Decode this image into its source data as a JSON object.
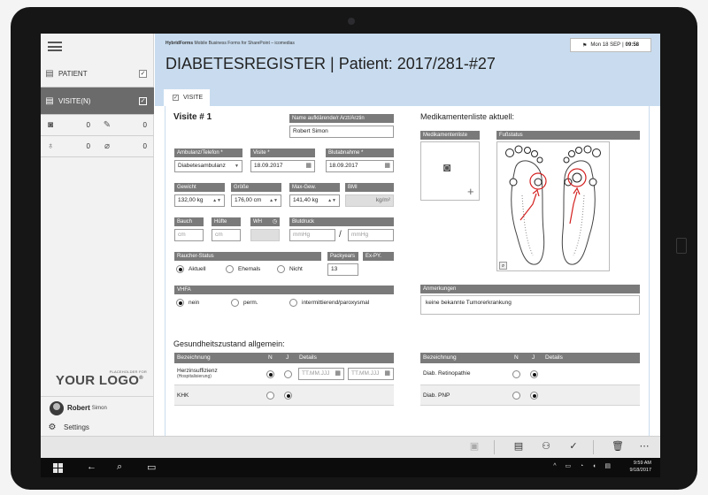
{
  "sidebar": {
    "nav": [
      {
        "label": "PATIENT",
        "checked": "✓"
      },
      {
        "label": "VISITE(N)",
        "checked": "✓"
      }
    ],
    "counters": [
      "0",
      "0",
      "0",
      "0"
    ],
    "logo_small": "PLACEHOLDER FOR",
    "logo": "YOUR LOGO",
    "logo_reg": "®",
    "user_first": "Robert",
    "user_last": "Simon",
    "settings": "Settings"
  },
  "header": {
    "brand_bold": "HybridForms",
    "brand_rest": " Mobile Business Forms for SharePoint – icomedias",
    "date": "Mon 18 SEP",
    "time": "09:58",
    "title": "DIABETESREGISTER | Patient: 2017/281-#27",
    "tab": "VISITE"
  },
  "form": {
    "visit_title": "Visite # 1",
    "arzt_label": "Name aufklärende/r Arzt/Arztin",
    "arzt_value": "Robert Simon",
    "ambulanz_label": "Ambulanz/Telefon *",
    "ambulanz_value": "Diabetesambulanz",
    "visite_label": "Visite *",
    "visite_value": "18.09.2017",
    "blutabnahme_label": "Blutabnahme *",
    "blutabnahme_value": "18.09.2017",
    "gewicht_label": "Gewicht",
    "gewicht_value": "132,00 kg",
    "groesse_label": "Größe",
    "groesse_value": "176,00 cm",
    "maxgew_label": "Max-Gew.",
    "maxgew_value": "141,40 kg",
    "bmi_label": "BMI",
    "bmi_value": "kg/m²",
    "bauch_label": "Bauch",
    "bauch_ph": "cm",
    "huefte_label": "Hüfte",
    "huefte_ph": "cm",
    "wh_label": "WH",
    "blutdruck_label": "Blutdruck",
    "blutdruck_ph1": "mmHg",
    "blutdruck_sep": "/",
    "blutdruck_ph2": "mmHg",
    "raucher_label": "Raucher-Status",
    "raucher_opts": [
      "Aktuell",
      "Ehemals",
      "Nicht"
    ],
    "packyears_label": "Packyears",
    "packyears_value": "13",
    "expy_label": "Ex-PY.",
    "vhfa_label": "VHFA",
    "vhfa_opts": [
      "nein",
      "perm.",
      "intermittierend/paroxysmal"
    ],
    "med_title": "Medikamentenliste aktuell:",
    "med_label": "Medikamentenliste",
    "fuss_label": "Fußstatus",
    "anm_label": "Anmerkungen",
    "anm_value": "keine bekannte Tumorerkrankung",
    "gz_title": "Gesundheitszustand allgemein:",
    "col_bez": "Bezeichnung",
    "col_n": "N",
    "col_j": "J",
    "col_det": "Details",
    "date_ph": "TT.MM.JJJ",
    "left_rows": [
      {
        "name": "Herzinsuffizienz",
        "sub": "(Hospitalisierung)"
      },
      {
        "name": "KHK",
        "sub": ""
      }
    ],
    "right_rows": [
      {
        "name": "Diab. Retinopathie"
      },
      {
        "name": "Diab. PNP"
      }
    ]
  },
  "taskbar": {
    "time": "9:59 AM",
    "date": "9/18/2017"
  }
}
